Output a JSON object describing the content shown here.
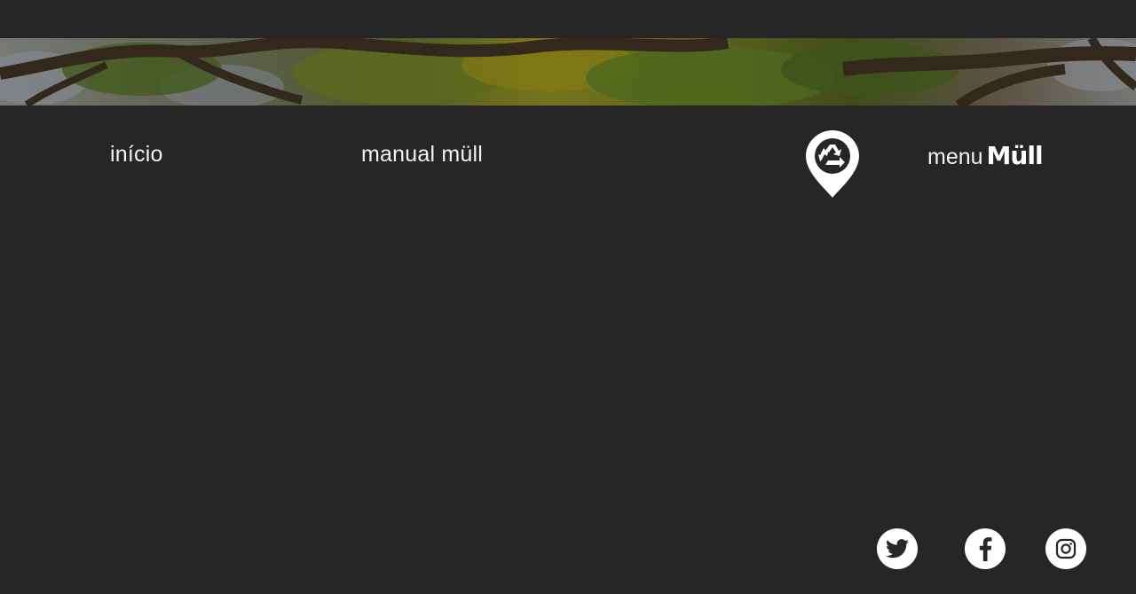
{
  "banner": {
    "image_description": "tree-canopy-photo"
  },
  "nav": {
    "inicio_label": "início",
    "manual_label": "manual müll"
  },
  "map_pin": {
    "icon": "recycle-location-pin-icon"
  },
  "menu": {
    "word": "menu",
    "brand": "Müll"
  },
  "social": {
    "twitter_icon": "twitter-icon",
    "facebook_icon": "facebook-icon",
    "instagram_icon": "instagram-icon"
  },
  "colors": {
    "background": "#262626",
    "text": "#f2f2f2",
    "icon_fill": "#ffffff",
    "icon_glyph": "#262626"
  }
}
